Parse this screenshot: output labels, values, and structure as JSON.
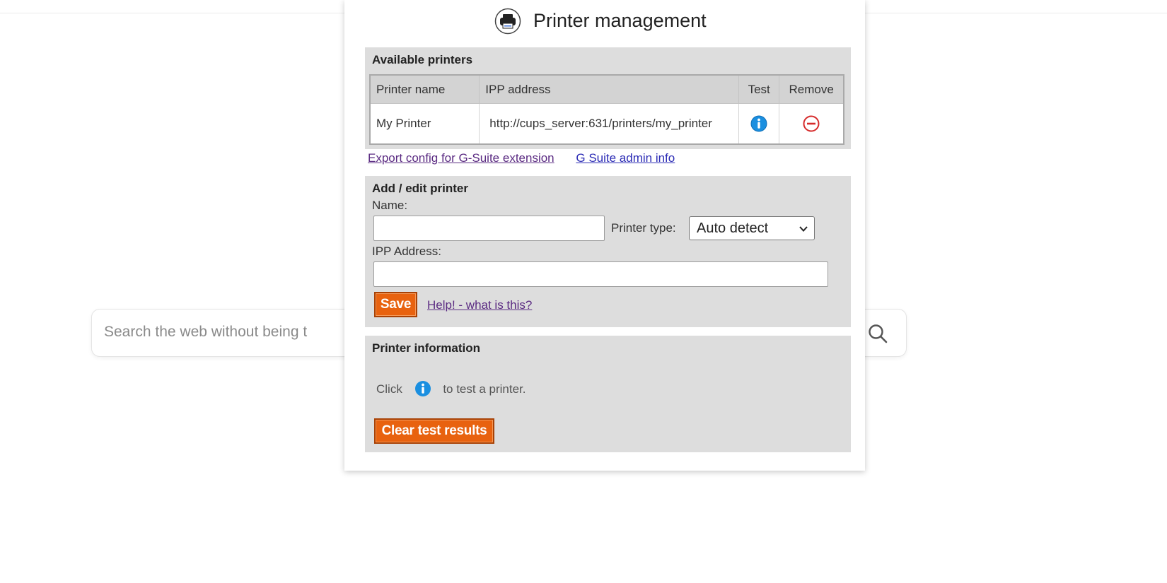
{
  "background": {
    "search_placeholder": "Search the web without being t"
  },
  "popup": {
    "title": "Printer management",
    "available": {
      "title": "Available printers",
      "columns": [
        "Printer name",
        "IPP address",
        "Test",
        "Remove"
      ],
      "rows": [
        {
          "name": "My Printer",
          "ipp": "http://cups_server:631/printers/my_printer"
        }
      ]
    },
    "links": {
      "export": "Export config for G-Suite extension",
      "admin": "G Suite admin info"
    },
    "edit": {
      "title": "Add / edit printer",
      "name_label": "Name:",
      "name_value": "",
      "type_label": "Printer type:",
      "type_value": "Auto detect",
      "ipp_label": "IPP Address:",
      "ipp_value": "",
      "save_label": "Save",
      "help_label": "Help! - what is this?"
    },
    "info": {
      "title": "Printer information",
      "text_before": "Click",
      "text_after": "to test a printer.",
      "clear_label": "Clear test results"
    }
  },
  "colors": {
    "button_orange": "#e8620f",
    "info_blue": "#1a8fe0",
    "remove_red": "#d62b2b",
    "panel_gray": "#dddddd"
  }
}
